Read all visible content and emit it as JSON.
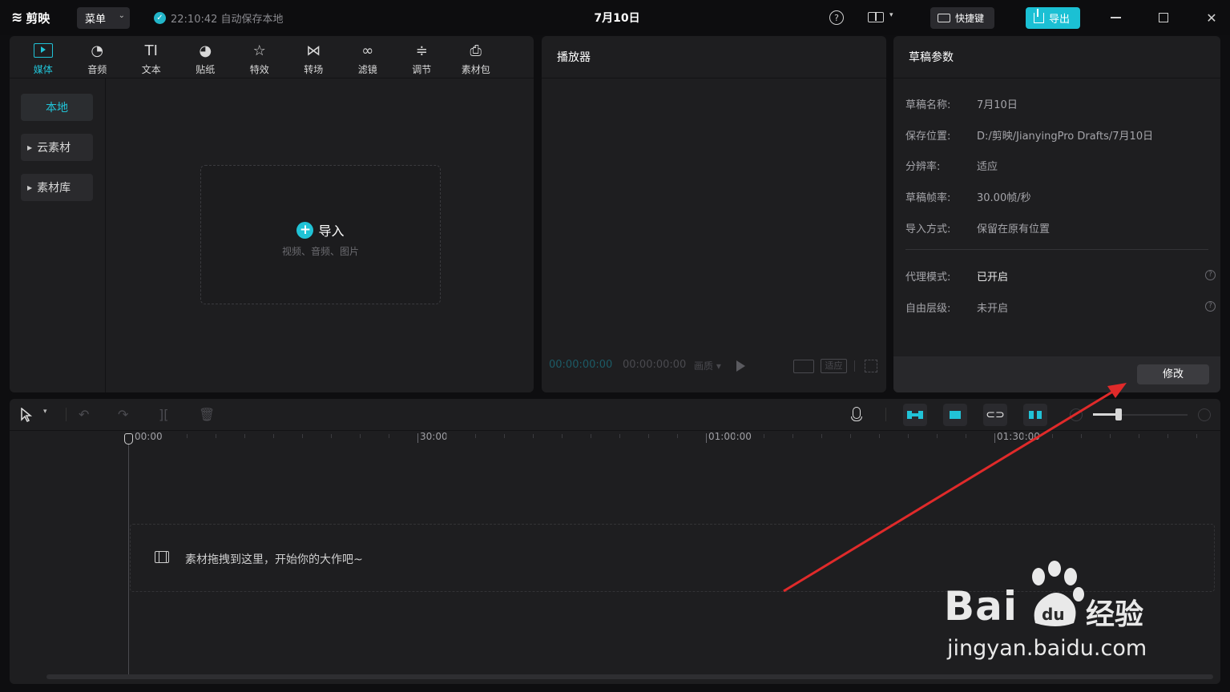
{
  "app": {
    "logo_text": "剪映",
    "menu_label": "菜单",
    "autosave_text": "22:10:42 自动保存本地",
    "project_title": "7月10日",
    "shortcut_label": "快捷键",
    "export_label": "导出",
    "accent_color": "#21c3d7"
  },
  "media_toolbar": {
    "tools": [
      {
        "label": "媒体",
        "icon": "media-icon"
      },
      {
        "label": "音频",
        "icon": "audio-icon"
      },
      {
        "label": "文本",
        "icon": "text-icon",
        "glyph": "TI"
      },
      {
        "label": "贴纸",
        "icon": "sticker-icon"
      },
      {
        "label": "特效",
        "icon": "effects-icon"
      },
      {
        "label": "转场",
        "icon": "transition-icon"
      },
      {
        "label": "滤镜",
        "icon": "filter-icon"
      },
      {
        "label": "调节",
        "icon": "adjust-icon"
      },
      {
        "label": "素材包",
        "icon": "package-icon"
      }
    ]
  },
  "media_side": {
    "items": [
      {
        "label": "本地"
      },
      {
        "label": "云素材"
      },
      {
        "label": "素材库"
      }
    ]
  },
  "import": {
    "label": "导入",
    "sub": "视频、音频、图片"
  },
  "player": {
    "title": "播放器",
    "timecode_current": "00:00:00:00",
    "timecode_total": "00:00:00:00",
    "ratio_label": "画质",
    "fit_label": "适应"
  },
  "draft": {
    "title": "草稿参数",
    "rows": [
      {
        "key": "草稿名称:",
        "value": "7月10日"
      },
      {
        "key": "保存位置:",
        "value": "D:/剪映/JianyingPro Drafts/7月10日"
      },
      {
        "key": "分辨率:",
        "value": "适应"
      },
      {
        "key": "草稿帧率:",
        "value": "30.00帧/秒"
      },
      {
        "key": "导入方式:",
        "value": "保留在原有位置"
      },
      {
        "key": "代理模式:",
        "value": "已开启"
      },
      {
        "key": "自由层级:",
        "value": "未开启"
      }
    ],
    "modify_label": "修改"
  },
  "timeline": {
    "ruler_labels": [
      "00:00",
      "30:00",
      "01:00:00",
      "01:30:00"
    ],
    "drop_text": "素材拖拽到这里，开始你的大作吧~"
  },
  "watermark": {
    "brand": "Bai",
    "du": "du",
    "jingyan": "经验",
    "url": "jingyan.baidu.com"
  }
}
